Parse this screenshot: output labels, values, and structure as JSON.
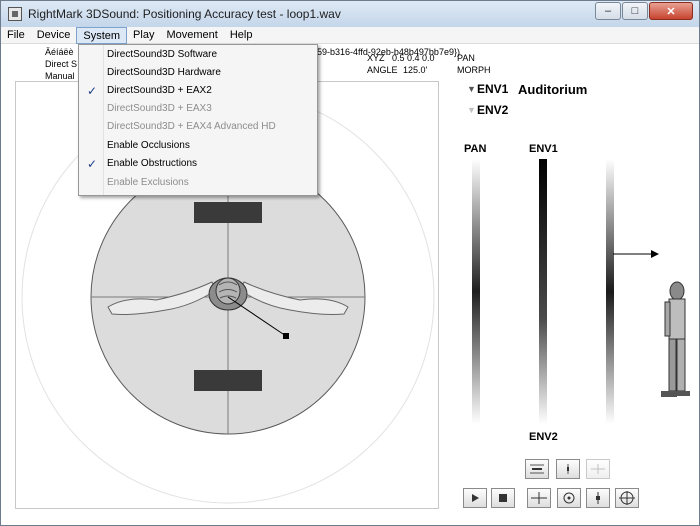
{
  "window": {
    "title": "RightMark 3DSound: Positioning Accuracy test - loop1.wav",
    "controls": {
      "minimize": "–",
      "maximize": "□",
      "close": "✕"
    }
  },
  "menubar": {
    "items": [
      "File",
      "Device",
      "System",
      "Play",
      "Movement",
      "Help"
    ],
    "active": "System"
  },
  "system_menu": {
    "items": [
      {
        "label": "DirectSound3D Software",
        "checked": false,
        "enabled": true
      },
      {
        "label": "DirectSound3D Hardware",
        "checked": false,
        "enabled": true
      },
      {
        "label": "DirectSound3D + EAX2",
        "checked": true,
        "enabled": true
      },
      {
        "label": "DirectSound3D + EAX3",
        "checked": false,
        "enabled": false
      },
      {
        "label": "DirectSound3D + EAX4 Advanced HD",
        "checked": false,
        "enabled": false
      },
      {
        "label": "Enable Occlusions",
        "checked": false,
        "enabled": true
      },
      {
        "label": "Enable Obstructions",
        "checked": true,
        "enabled": true
      },
      {
        "label": "Enable Exclusions",
        "checked": false,
        "enabled": false
      }
    ]
  },
  "info": {
    "line1_left": "Äéíáëè",
    "line1_right": "59-b316-4ffd-92eb-b48b497bb7e9})",
    "line2_left": "Direct S",
    "line3_left": "Manual",
    "xyz_label": "XYZ",
    "xyz_value": "0.5 0.4 0.0",
    "angle_label": "ANGLE",
    "angle_value": "125.0'",
    "pan": "PAN",
    "morph": "MORPH"
  },
  "environment": {
    "env1_label": "ENV1",
    "env1_name": "Auditorium",
    "env2_label": "ENV2"
  },
  "sliders": {
    "pan_label": "PAN",
    "env1_label": "ENV1",
    "env2_label": "ENV2"
  },
  "icons": {
    "play": "play-icon",
    "stop": "stop-icon",
    "check": "✓"
  },
  "colors": {
    "titlebar": "#c4d6ea",
    "menu_active": "#dce8f6",
    "check": "#1d3c88",
    "close_button": "#c7442f"
  }
}
